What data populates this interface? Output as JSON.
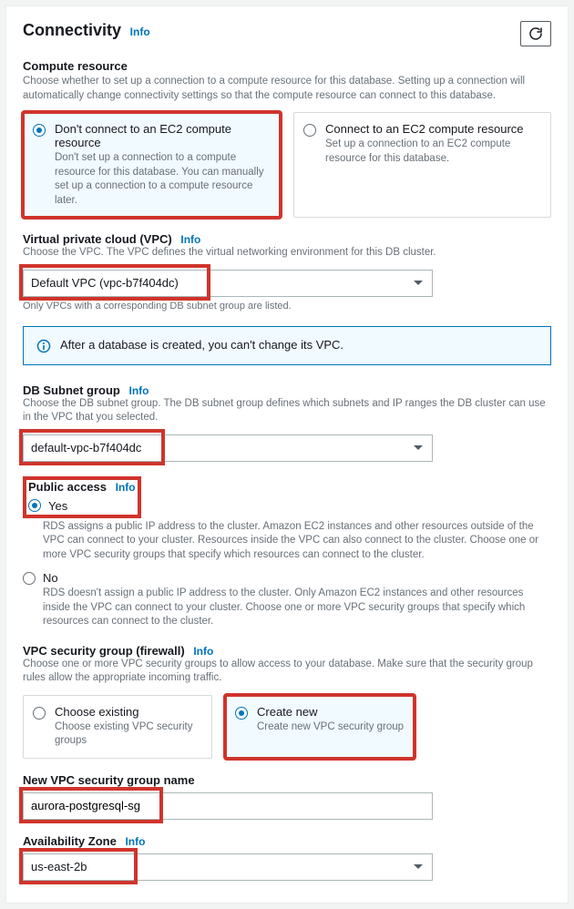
{
  "panel": {
    "title": "Connectivity",
    "info": "Info"
  },
  "compute": {
    "title": "Compute resource",
    "desc": "Choose whether to set up a connection to a compute resource for this database. Setting up a connection will automatically change connectivity settings so that the compute resource can connect to this database.",
    "noconnect": {
      "title": "Don't connect to an EC2 compute resource",
      "desc": "Don't set up a connection to a compute resource for this database. You can manually set up a connection to a compute resource later."
    },
    "connect": {
      "title": "Connect to an EC2 compute resource",
      "desc": "Set up a connection to an EC2 compute resource for this database."
    }
  },
  "vpc": {
    "title": "Virtual private cloud (VPC)",
    "info": "Info",
    "desc": "Choose the VPC. The VPC defines the virtual networking environment for this DB cluster.",
    "value": "Default VPC (vpc-b7f404dc)",
    "helper": "Only VPCs with a corresponding DB subnet group are listed."
  },
  "banner": "After a database is created, you can't change its VPC.",
  "subnet": {
    "title": "DB Subnet group",
    "info": "Info",
    "desc": "Choose the DB subnet group. The DB subnet group defines which subnets and IP ranges the DB cluster can use in the VPC that you selected.",
    "value": "default-vpc-b7f404dc"
  },
  "public": {
    "title": "Public access",
    "info": "Info",
    "yes": "Yes",
    "yes_desc": "RDS assigns a public IP address to the cluster. Amazon EC2 instances and other resources outside of the VPC can connect to your cluster. Resources inside the VPC can also connect to the cluster. Choose one or more VPC security groups that specify which resources can connect to the cluster.",
    "no": "No",
    "no_desc": "RDS doesn't assign a public IP address to the cluster. Only Amazon EC2 instances and other resources inside the VPC can connect to your cluster. Choose one or more VPC security groups that specify which resources can connect to the cluster."
  },
  "sg": {
    "title": "VPC security group (firewall)",
    "info": "Info",
    "desc": "Choose one or more VPC security groups to allow access to your database. Make sure that the security group rules allow the appropriate incoming traffic.",
    "existing": {
      "title": "Choose existing",
      "desc": "Choose existing VPC security groups"
    },
    "create": {
      "title": "Create new",
      "desc": "Create new VPC security group"
    }
  },
  "sgname": {
    "title": "New VPC security group name",
    "value": "aurora-postgresql-sg"
  },
  "az": {
    "title": "Availability Zone",
    "info": "Info",
    "value": "us-east-2b"
  }
}
